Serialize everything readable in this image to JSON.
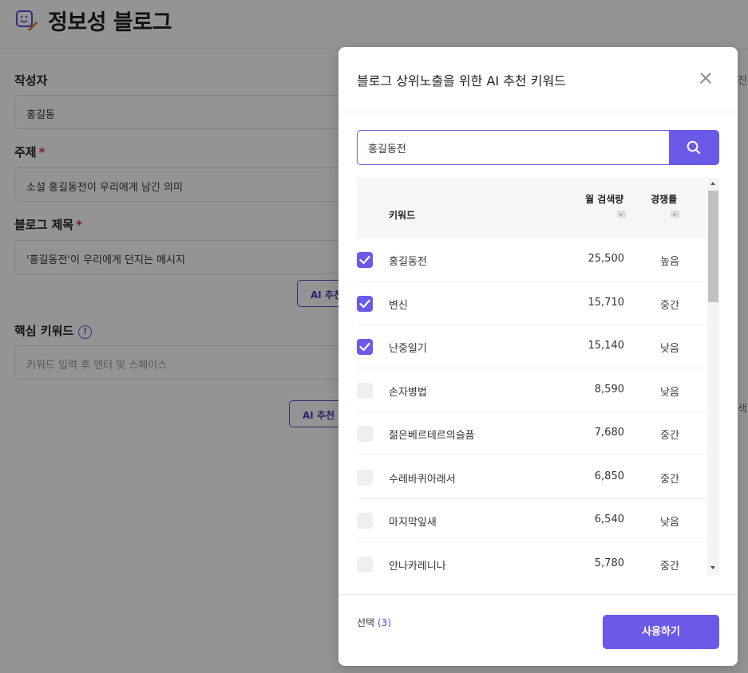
{
  "page": {
    "title": "정보성 블로그",
    "author_label": "작성자",
    "author_value": "홍길동",
    "topic_label": "주제",
    "topic_value": "소설 홍길동전이 우리에게 남긴 의미",
    "blog_title_label": "블로그 제목",
    "blog_title_value": "'홍길동전'이 우리에게 던지는 메시지",
    "ai_button_1": "AI 추천",
    "keywords_label": "핵심 키워드",
    "info_icon_glyph": "!",
    "keywords_placeholder": "키워드 입력 후 엔터 및 스페이스",
    "ai_button_2": "AI 추천 키",
    "right_fragment_1": "진",
    "right_fragment_2": "색"
  },
  "modal": {
    "title": "블로그 상위노출을 위한 AI 추천 키워드",
    "search_value": "홍길동전",
    "columns": {
      "keyword": "키워드",
      "volume": "월 검색량",
      "competition": "경쟁률"
    },
    "rows": [
      {
        "keyword": "홍길동전",
        "volume": "25,500",
        "competition": "높음",
        "checked": true
      },
      {
        "keyword": "변신",
        "volume": "15,710",
        "competition": "중간",
        "checked": true
      },
      {
        "keyword": "난중일기",
        "volume": "15,140",
        "competition": "낮음",
        "checked": true
      },
      {
        "keyword": "손자병법",
        "volume": "8,590",
        "competition": "낮음",
        "checked": false
      },
      {
        "keyword": "젊은베르테르의슬픔",
        "volume": "7,680",
        "competition": "중간",
        "checked": false
      },
      {
        "keyword": "수레바퀴아래서",
        "volume": "6,850",
        "competition": "중간",
        "checked": false
      },
      {
        "keyword": "마지막잎새",
        "volume": "6,540",
        "competition": "낮음",
        "checked": false
      },
      {
        "keyword": "안나카레니나",
        "volume": "5,780",
        "competition": "중간",
        "checked": false
      }
    ],
    "footer": {
      "selected_label": "선택",
      "selected_count": "(3)",
      "use_button": "사용하기"
    }
  },
  "colors": {
    "accent": "#6b5ae8",
    "required": "#d8344f"
  },
  "icons": {
    "logo": "blog-edit-icon",
    "info": "info-icon",
    "close": "close-icon",
    "search": "search-icon",
    "check": "check-icon"
  }
}
